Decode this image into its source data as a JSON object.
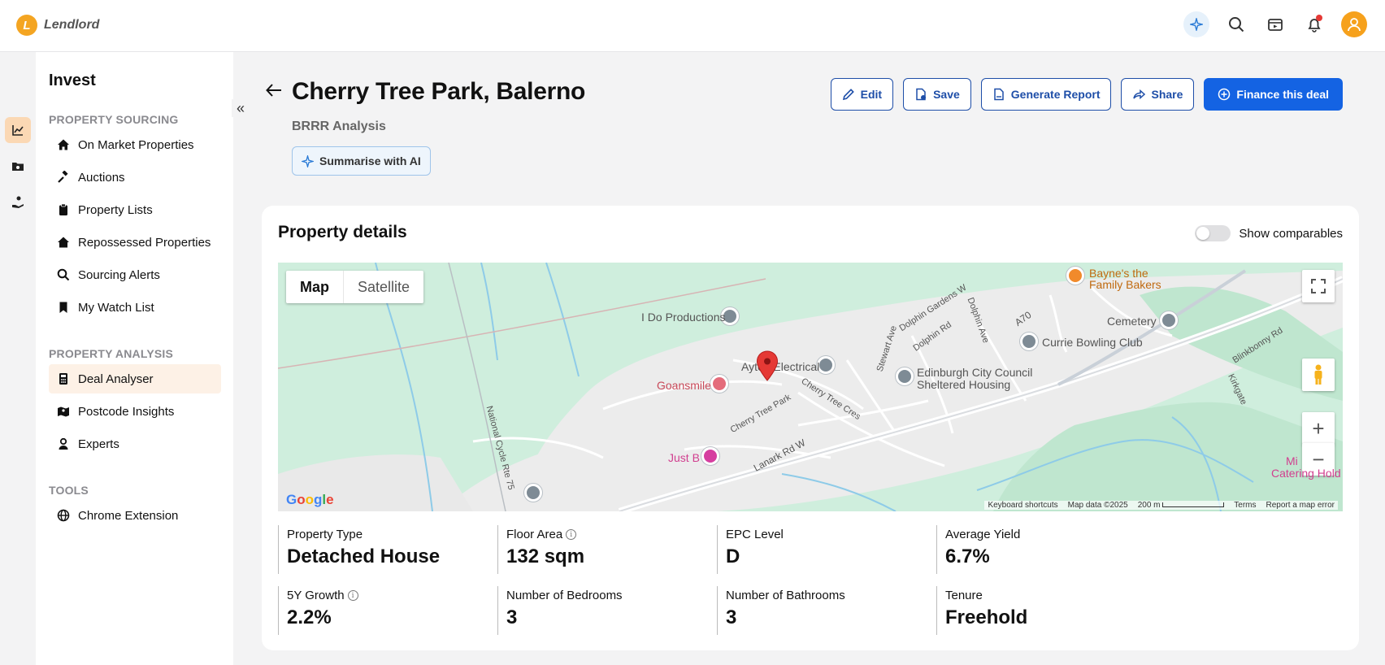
{
  "brand": {
    "name": "Lendlord",
    "mark": "L"
  },
  "sidebar": {
    "title": "Invest",
    "sections": [
      {
        "label": "PROPERTY SOURCING",
        "items": [
          {
            "label": "On Market Properties",
            "icon": "home-icon"
          },
          {
            "label": "Auctions",
            "icon": "gavel-icon"
          },
          {
            "label": "Property Lists",
            "icon": "clipboard-icon"
          },
          {
            "label": "Repossessed Properties",
            "icon": "home-icon"
          },
          {
            "label": "Sourcing Alerts",
            "icon": "search-icon"
          },
          {
            "label": "My Watch List",
            "icon": "bookmark-icon"
          }
        ]
      },
      {
        "label": "PROPERTY ANALYSIS",
        "items": [
          {
            "label": "Deal Analyser",
            "icon": "calculator-icon",
            "active": true
          },
          {
            "label": "Postcode Insights",
            "icon": "map-icon"
          },
          {
            "label": "Experts",
            "icon": "user-icon"
          }
        ]
      },
      {
        "label": "TOOLS",
        "items": [
          {
            "label": "Chrome Extension",
            "icon": "globe-icon"
          }
        ]
      }
    ]
  },
  "header": {
    "title": "Cherry Tree Park, Balerno",
    "subtitle": "BRRR Analysis",
    "ai_button": "Summarise with AI",
    "actions": {
      "edit": "Edit",
      "save": "Save",
      "report": "Generate Report",
      "share": "Share",
      "finance": "Finance this deal"
    }
  },
  "card": {
    "title": "Property details",
    "toggle_label": "Show comparables",
    "map": {
      "tab_map": "Map",
      "tab_satellite": "Satellite",
      "labels": {
        "productions": "I Do Productions",
        "electrical": "Ayton Electrical",
        "goansmile": "Goansmile",
        "justb": "Just B",
        "council": "Edinburgh City Council",
        "council2": "Sheltered Housing",
        "bowling": "Currie Bowling Club",
        "cemetery": "Cemetery",
        "bakers1": "Bayne's the",
        "bakers2": "Family Bakers",
        "catering1": "Mi",
        "catering2": "Catering Hold",
        "r_cherrypark": "Cherry Tree Park",
        "r_cherrycres": "Cherry Tree Cres",
        "r_lanark": "Lanark Rd W",
        "r_cycle": "National Cycle Rte 75",
        "r_stewart": "Stewart Ave",
        "r_dolphinrd": "Dolphin Rd",
        "r_dolphinave": "Dolphin Ave",
        "r_dolphingdns": "Dolphin Gardens W",
        "r_a70": "A70",
        "r_blinkbonny": "Blinkbonny Rd",
        "r_kirkgate": "Kirkgate"
      },
      "footer": {
        "shortcuts": "Keyboard shortcuts",
        "data": "Map data ©2025",
        "scale": "200 m",
        "terms": "Terms",
        "report": "Report a map error"
      },
      "google": [
        "G",
        "o",
        "o",
        "g",
        "l",
        "e"
      ]
    },
    "stats": [
      {
        "label": "Property Type",
        "value": "Detached House",
        "info": false
      },
      {
        "label": "Floor Area",
        "value": "132 sqm",
        "info": true
      },
      {
        "label": "EPC Level",
        "value": "D",
        "info": false
      },
      {
        "label": "Average Yield",
        "value": "6.7%",
        "info": false
      },
      {
        "label": "5Y Growth",
        "value": "2.2%",
        "info": true
      },
      {
        "label": "Number of Bedrooms",
        "value": "3",
        "info": false
      },
      {
        "label": "Number of Bathrooms",
        "value": "3",
        "info": false
      },
      {
        "label": "Tenure",
        "value": "Freehold",
        "info": false
      }
    ]
  },
  "colors": {
    "accent": "#1463e3",
    "brand": "#f4a522",
    "active_bg": "#fdf1e6"
  }
}
